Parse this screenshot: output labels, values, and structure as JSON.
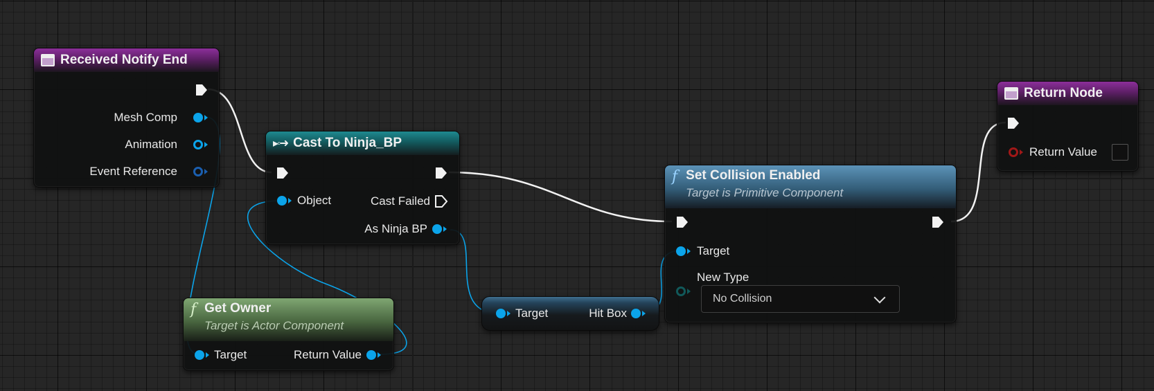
{
  "colors": {
    "canvas_bg": "#262626",
    "object_pin": "#0ba4ea",
    "exec_wire": "#f2f2f2",
    "event_header": "#8c2f9a",
    "cast_header": "#1e8a90",
    "func_header_green": "#7fa672",
    "func_header_blue": "#5c93b8",
    "bool_pin": "#a01818"
  },
  "nodes": {
    "received_notify_end": {
      "title": "Received Notify End",
      "icon": "event-icon",
      "pins": {
        "mesh_comp": "Mesh Comp",
        "animation": "Animation",
        "event_reference": "Event Reference"
      }
    },
    "cast_to_ninja": {
      "title": "Cast To Ninja_BP",
      "icon": "cast-icon",
      "pins": {
        "object": "Object",
        "cast_failed": "Cast Failed",
        "as_ninja_bp": "As Ninja BP"
      }
    },
    "get_owner": {
      "title": "Get Owner",
      "subtitle": "Target is Actor Component",
      "icon": "function-icon",
      "pins": {
        "target": "Target",
        "return_value": "Return Value"
      }
    },
    "hit_box": {
      "pins": {
        "target": "Target",
        "hit_box": "Hit Box"
      }
    },
    "set_collision_enabled": {
      "title": "Set Collision Enabled",
      "subtitle": "Target is Primitive Component",
      "icon": "function-icon",
      "pins": {
        "target": "Target",
        "new_type": "New Type"
      },
      "new_type_value": "No Collision"
    },
    "return_node": {
      "title": "Return Node",
      "icon": "event-icon",
      "pins": {
        "return_value": "Return Value"
      }
    }
  }
}
